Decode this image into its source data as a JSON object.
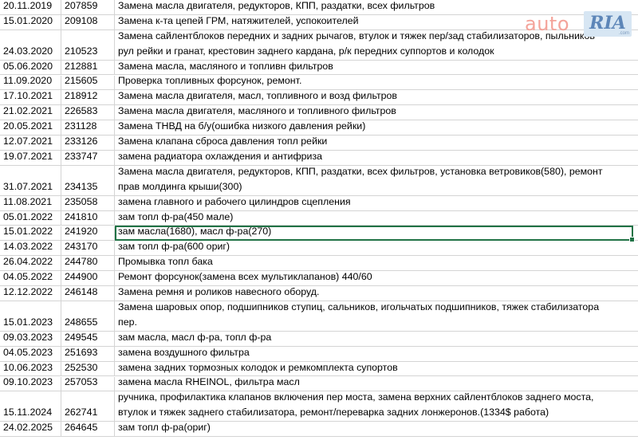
{
  "logo": {
    "left_text": "auto",
    "right_text": "RIA",
    "suffix": ".com"
  },
  "rows": [
    {
      "date": "20.11.2019",
      "km": "207859",
      "text": "Замена масла двигателя, редукторов, КПП, раздатки, всех фильтров"
    },
    {
      "date": "15.01.2020",
      "km": "209108",
      "text": "Замена к-та цепей ГРМ, натяжителей, успокоителей"
    },
    {
      "date": "24.03.2020",
      "km": "210523",
      "text": "Замена сайлентблоков передних и задних рычагов, втулок и тяжек пер/зад стабилизаторов, пыльников\nрул рейки и гранат, крестовин заднего кардана, р/к передних суппортов и колодок"
    },
    {
      "date": "05.06.2020",
      "km": "212881",
      "text": "Замена масла, масляного и топливн фильтров"
    },
    {
      "date": "11.09.2020",
      "km": "215605",
      "text": "Проверка топливных форсунок, ремонт."
    },
    {
      "date": "17.10.2021",
      "km": "218912",
      "text": "Замена масла двигателя, масл, топливного и возд фильтров"
    },
    {
      "date": "21.02.2021",
      "km": "226583",
      "text": "Замена масла двигателя, масляного и топливного фильтров"
    },
    {
      "date": "20.05.2021",
      "km": "231128",
      "text": "Замена ТНВД на б/у(ошибка низкого давления рейки)"
    },
    {
      "date": "12.07.2021",
      "km": "233126",
      "text": "Замена клапана сброса давления топл рейки"
    },
    {
      "date": "19.07.2021",
      "km": "233747",
      "text": "замена радиатора охлаждения и антифриза"
    },
    {
      "date": "31.07.2021",
      "km": "234135",
      "text": "Замена масла двигателя, редукторов, КПП, раздатки, всех фильтров, установка ветровиков(580), ремонт\nправ молдинга крыши(300)"
    },
    {
      "date": "11.08.2021",
      "km": "235058",
      "text": "замена главного и рабочего цилиндров сцепления"
    },
    {
      "date": "05.01.2022",
      "km": "241810",
      "text": "зам топл ф-ра(450 мале)"
    },
    {
      "date": "15.01.2022",
      "km": "241920",
      "text": "зам масла(1680), масл ф-ра(270)"
    },
    {
      "date": "14.03.2022",
      "km": "243170",
      "text": "зам топл ф-ра(600 ориг)"
    },
    {
      "date": "26.04.2022",
      "km": "244780",
      "text": "Промывка топл бака"
    },
    {
      "date": "04.05.2022",
      "km": "244900",
      "text": "Ремонт форсунок(замена всех мультиклапанов) 440/60"
    },
    {
      "date": "12.12.2022",
      "km": "246148",
      "text": "Замена ремня и роликов навесного оборуд."
    },
    {
      "date": "15.01.2023",
      "km": "248655",
      "text": "Замена шаровых опор, подшипников ступиц, сальников, игольчатых подшипников, тяжек стабилизатора\nпер."
    },
    {
      "date": "09.03.2023",
      "km": "249545",
      "text": "зам масла, масл ф-ра, топл ф-ра"
    },
    {
      "date": "04.05.2023",
      "km": "251693",
      "text": "замена воздушного фильтра"
    },
    {
      "date": "10.06.2023",
      "km": "252530",
      "text": "замена задних тормозных колодок и ремкомплекта супортов"
    },
    {
      "date": "09.10.2023",
      "km": "257053",
      "text": "замена масла RHEINOL, фильтра масл"
    },
    {
      "date": "15.11.2024",
      "km": "262741",
      "text": "ручника, профилактика клапанов включения пер моста, замена верхних сайлентблоков заднего моста,\nвтулок и тяжек заднего стабилизатора, ремонт/переварка задних лонжеронов.(1334$ работа)"
    },
    {
      "date": "24.02.2025",
      "km": "264645",
      "text": "зам топл ф-ра(ориг)"
    }
  ]
}
